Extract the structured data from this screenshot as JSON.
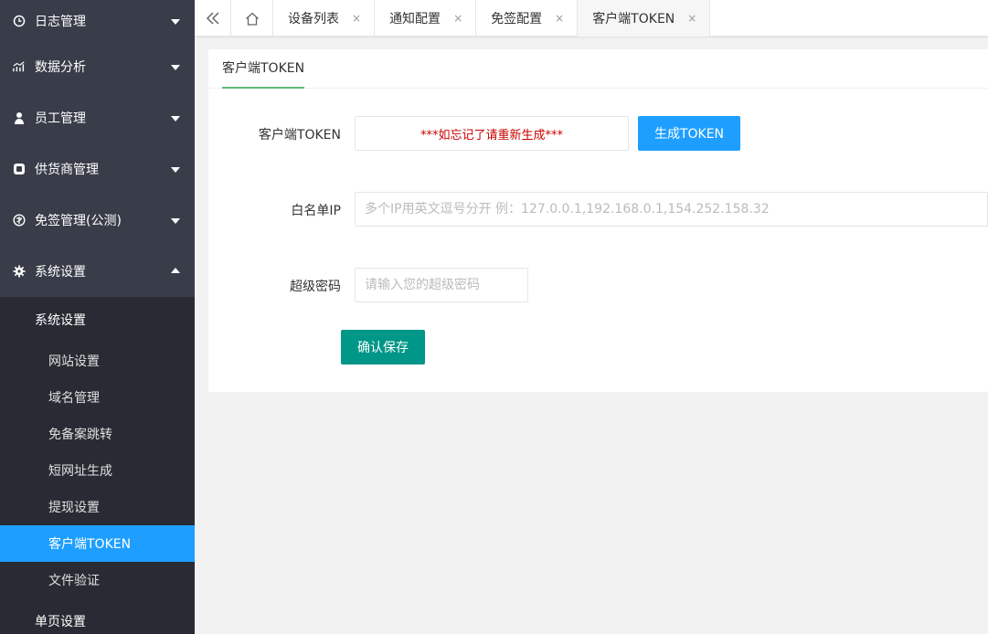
{
  "sidebar": {
    "menus": [
      {
        "label": "日志管理",
        "icon": "clock-icon"
      },
      {
        "label": "数据分析",
        "icon": "chart-icon"
      },
      {
        "label": "员工管理",
        "icon": "user-icon"
      },
      {
        "label": "供货商管理",
        "icon": "supplier-icon"
      },
      {
        "label": "免签管理(公测)",
        "icon": "sign-icon"
      },
      {
        "label": "系统设置",
        "icon": "gear-icon"
      }
    ],
    "submenu_title": "系统设置",
    "submenu_items": [
      "网站设置",
      "域名管理",
      "免备案跳转",
      "短网址生成",
      "提现设置",
      "客户端TOKEN",
      "文件验证"
    ],
    "tail_menu": "单页设置"
  },
  "tabs": {
    "items": [
      {
        "label": "设备列表"
      },
      {
        "label": "通知配置"
      },
      {
        "label": "免签配置"
      },
      {
        "label": "客户端TOKEN"
      }
    ],
    "close_glyph": "×"
  },
  "card": {
    "title": "客户端TOKEN",
    "token_label": "客户端TOKEN",
    "token_value": "***如忘记了请重新生成***",
    "generate_button": "生成TOKEN",
    "whitelist_label": "白名单IP",
    "whitelist_placeholder": "多个IP用英文逗号分开 例：127.0.0.1,192.168.0.1,154.252.158.32",
    "password_label": "超级密码",
    "password_placeholder": "请输入您的超级密码",
    "save_button": "确认保存"
  },
  "colors": {
    "sidebar_bg": "#393d49",
    "sidebar_sub_bg": "#282b33",
    "active_blue": "#1e9fff",
    "save_green": "#009688",
    "token_red": "#cc0000",
    "tab_underline": "#5fb878"
  }
}
